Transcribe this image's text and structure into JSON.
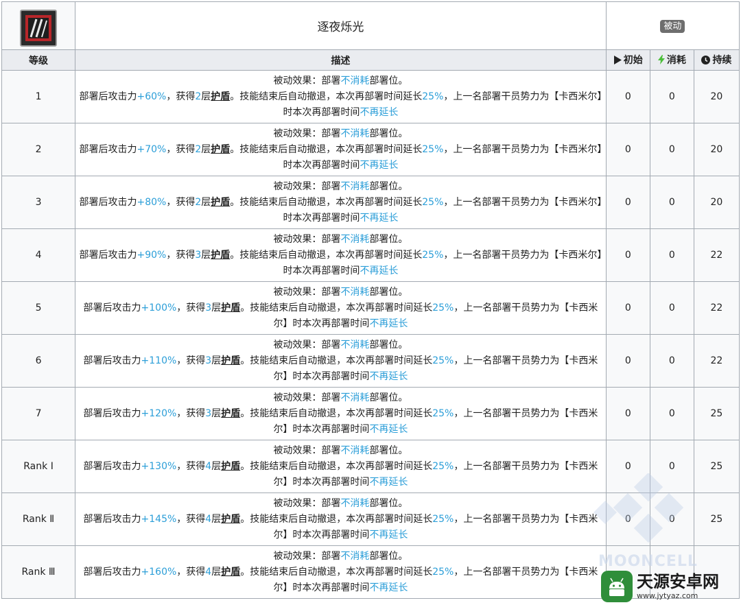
{
  "skill": {
    "name": "逐夜烁光",
    "type": "被动",
    "icon": "skill-claw-icon"
  },
  "columns": {
    "level": "等级",
    "desc": "描述",
    "initial": "初始",
    "cost": "消耗",
    "duration": "持续"
  },
  "rows": [
    {
      "level": "1",
      "passive_a": "被动效果：部署",
      "passive_b": "不消耗",
      "passive_c": "部署位。",
      "l2a": "部署后攻击力",
      "atk": "+60%",
      "l2b": "，获得",
      "layers": "2",
      "l2c": "层",
      "shield": "护盾",
      "l2d": "。技能结束后自动撤退，本次再部署时间延长",
      "extend": "25%",
      "l2e": "，上一名部署干员势力为【卡西米尔】时本次再部署时间",
      "noext": "不再延长",
      "initial": "0",
      "cost": "0",
      "duration": "20"
    },
    {
      "level": "2",
      "passive_a": "被动效果：部署",
      "passive_b": "不消耗",
      "passive_c": "部署位。",
      "l2a": "部署后攻击力",
      "atk": "+70%",
      "l2b": "，获得",
      "layers": "2",
      "l2c": "层",
      "shield": "护盾",
      "l2d": "。技能结束后自动撤退，本次再部署时间延长",
      "extend": "25%",
      "l2e": "，上一名部署干员势力为【卡西米尔】时本次再部署时间",
      "noext": "不再延长",
      "initial": "0",
      "cost": "0",
      "duration": "20"
    },
    {
      "level": "3",
      "passive_a": "被动效果：部署",
      "passive_b": "不消耗",
      "passive_c": "部署位。",
      "l2a": "部署后攻击力",
      "atk": "+80%",
      "l2b": "，获得",
      "layers": "2",
      "l2c": "层",
      "shield": "护盾",
      "l2d": "。技能结束后自动撤退，本次再部署时间延长",
      "extend": "25%",
      "l2e": "，上一名部署干员势力为【卡西米尔】时本次再部署时间",
      "noext": "不再延长",
      "initial": "0",
      "cost": "0",
      "duration": "20"
    },
    {
      "level": "4",
      "passive_a": "被动效果：部署",
      "passive_b": "不消耗",
      "passive_c": "部署位。",
      "l2a": "部署后攻击力",
      "atk": "+90%",
      "l2b": "，获得",
      "layers": "3",
      "l2c": "层",
      "shield": "护盾",
      "l2d": "。技能结束后自动撤退，本次再部署时间延长",
      "extend": "25%",
      "l2e": "，上一名部署干员势力为【卡西米尔】时本次再部署时间",
      "noext": "不再延长",
      "initial": "0",
      "cost": "0",
      "duration": "22"
    },
    {
      "level": "5",
      "passive_a": "被动效果：部署",
      "passive_b": "不消耗",
      "passive_c": "部署位。",
      "l2a": "部署后攻击力",
      "atk": "+100%",
      "l2b": "，获得",
      "layers": "3",
      "l2c": "层",
      "shield": "护盾",
      "l2d": "。技能结束后自动撤退，本次再部署时间延长",
      "extend": "25%",
      "l2e": "，上一名部署干员势力为【卡西米尔】时本次再部署时间",
      "noext": "不再延长",
      "initial": "0",
      "cost": "0",
      "duration": "22"
    },
    {
      "level": "6",
      "passive_a": "被动效果：部署",
      "passive_b": "不消耗",
      "passive_c": "部署位。",
      "l2a": "部署后攻击力",
      "atk": "+110%",
      "l2b": "，获得",
      "layers": "3",
      "l2c": "层",
      "shield": "护盾",
      "l2d": "。技能结束后自动撤退，本次再部署时间延长",
      "extend": "25%",
      "l2e": "，上一名部署干员势力为【卡西米尔】时本次再部署时间",
      "noext": "不再延长",
      "initial": "0",
      "cost": "0",
      "duration": "22"
    },
    {
      "level": "7",
      "passive_a": "被动效果：部署",
      "passive_b": "不消耗",
      "passive_c": "部署位。",
      "l2a": "部署后攻击力",
      "atk": "+120%",
      "l2b": "，获得",
      "layers": "3",
      "l2c": "层",
      "shield": "护盾",
      "l2d": "。技能结束后自动撤退，本次再部署时间延长",
      "extend": "25%",
      "l2e": "，上一名部署干员势力为【卡西米尔】时本次再部署时间",
      "noext": "不再延长",
      "initial": "0",
      "cost": "0",
      "duration": "25"
    },
    {
      "level": "Rank Ⅰ",
      "passive_a": "被动效果：部署",
      "passive_b": "不消耗",
      "passive_c": "部署位。",
      "l2a": "部署后攻击力",
      "atk": "+130%",
      "l2b": "，获得",
      "layers": "4",
      "l2c": "层",
      "shield": "护盾",
      "l2d": "。技能结束后自动撤退，本次再部署时间延长",
      "extend": "25%",
      "l2e": "，上一名部署干员势力为【卡西米尔】时本次再部署时间",
      "noext": "不再延长",
      "initial": "0",
      "cost": "0",
      "duration": "25"
    },
    {
      "level": "Rank Ⅱ",
      "passive_a": "被动效果：部署",
      "passive_b": "不消耗",
      "passive_c": "部署位。",
      "l2a": "部署后攻击力",
      "atk": "+145%",
      "l2b": "，获得",
      "layers": "4",
      "l2c": "层",
      "shield": "护盾",
      "l2d": "。技能结束后自动撤退，本次再部署时间延长",
      "extend": "25%",
      "l2e": "，上一名部署干员势力为【卡西米尔】时本次再部署时间",
      "noext": "不再延长",
      "initial": "0",
      "cost": "0",
      "duration": "25"
    },
    {
      "level": "Rank Ⅲ",
      "passive_a": "被动效果：部署",
      "passive_b": "不消耗",
      "passive_c": "部署位。",
      "l2a": "部署后攻击力",
      "atk": "+160%",
      "l2b": "，获得",
      "layers": "4",
      "l2c": "层",
      "shield": "护盾",
      "l2d": "。技能结束后自动撤退，本次再部署时间延长",
      "extend": "25%",
      "l2e": "，上一名部署干员势力为【卡西米尔】时本次再部署时间",
      "noext": "不再延长",
      "initial": "",
      "cost": "",
      "duration": ""
    }
  ],
  "watermark": {
    "text": "MOONCELL",
    "site_name": "天源安卓网",
    "site_url": "www.jytyaz.com"
  },
  "colors": {
    "accent": "#2b9ed8",
    "header_bg": "#eaecf0",
    "cell_bg": "#f8f9fa",
    "border": "#a2a9b1",
    "logo_green": "#2f8e3a"
  }
}
